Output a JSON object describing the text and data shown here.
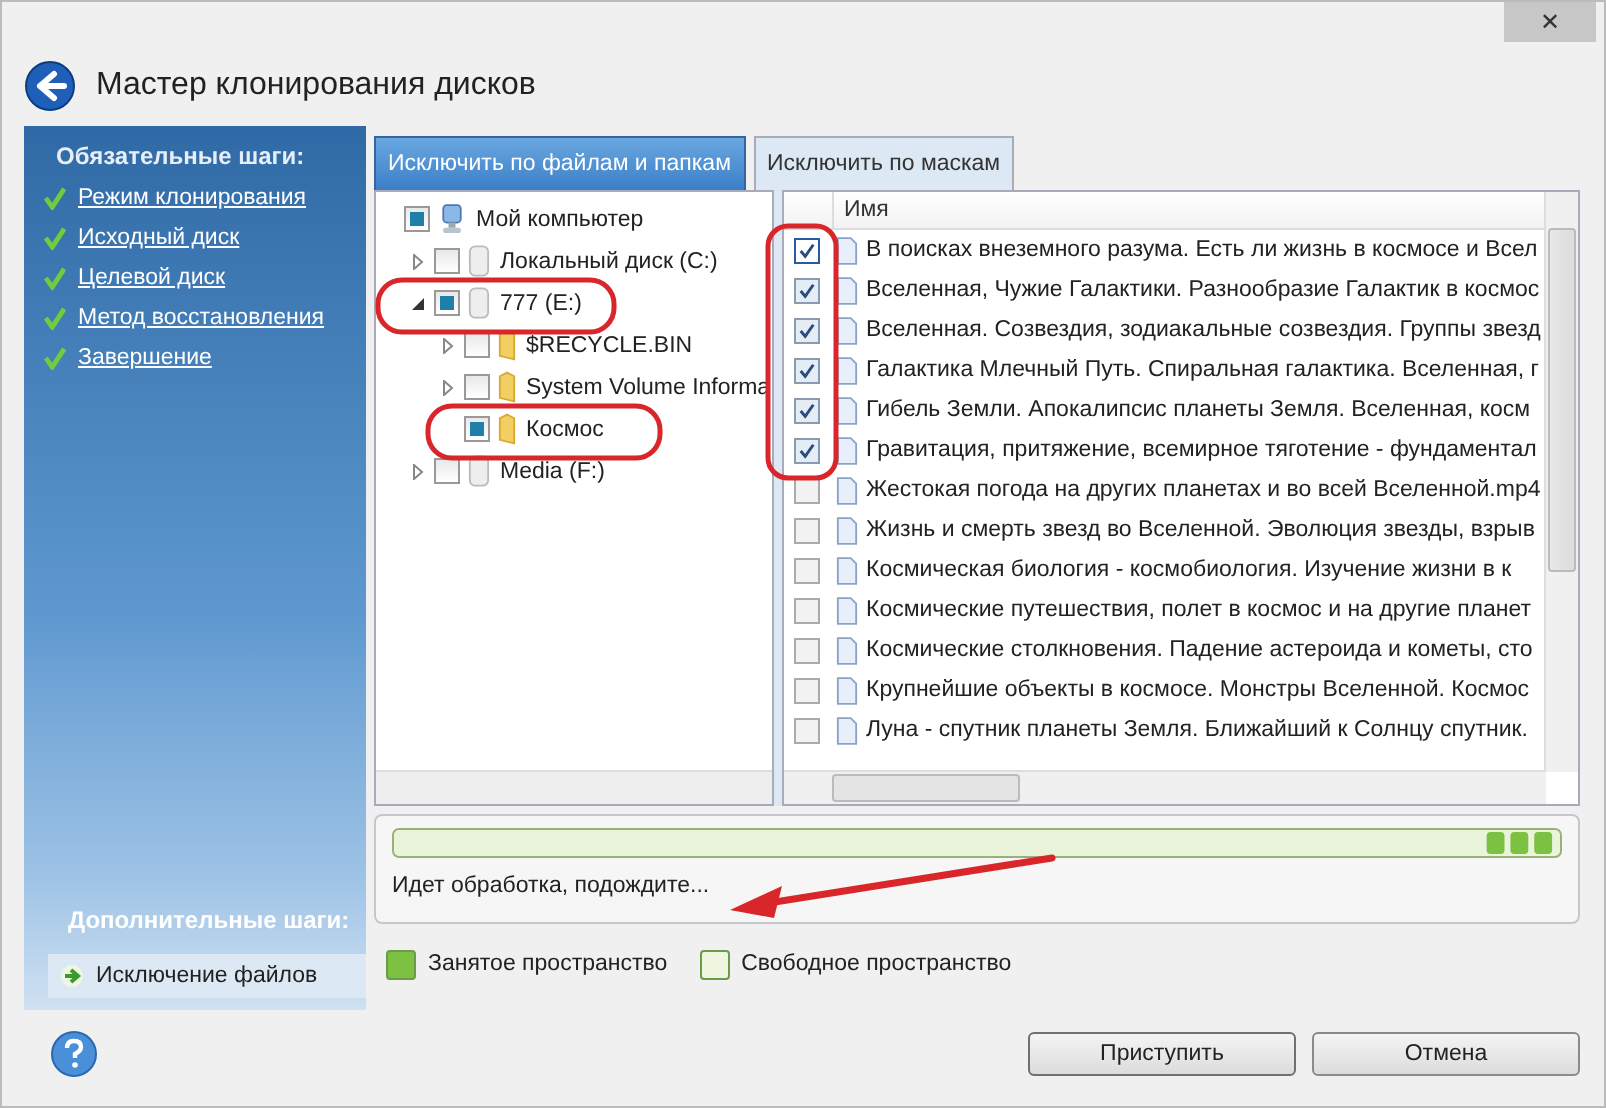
{
  "window": {
    "title": "Мастер клонирования дисков",
    "close": "✕"
  },
  "sidebar": {
    "required_heading": "Обязательные шаги:",
    "required_steps": [
      {
        "label": "Режим клонирования",
        "done": true
      },
      {
        "label": "Исходный диск",
        "done": true
      },
      {
        "label": "Целевой диск",
        "done": true
      },
      {
        "label": "Метод восстановления",
        "done": true
      },
      {
        "label": "Завершение",
        "done": true
      }
    ],
    "optional_heading": "Дополнительные шаги:",
    "optional_steps": [
      {
        "label": "Исключение файлов",
        "selected": true
      }
    ]
  },
  "tabs": [
    {
      "label": "Исключить по файлам и папкам",
      "selected": true
    },
    {
      "label": "Исключить по маскам",
      "selected": false
    }
  ],
  "tree": [
    {
      "label": "Мой компьютер",
      "kind": "computer",
      "checked": true,
      "children": [
        {
          "label": "Локальный диск (C:)",
          "kind": "drive",
          "checked": false,
          "expanded": false
        },
        {
          "label": "777 (E:)",
          "kind": "drive",
          "checked": true,
          "expanded": true,
          "children": [
            {
              "label": "$RECYCLE.BIN",
              "kind": "folder",
              "checked": false,
              "expanded": false
            },
            {
              "label": "System Volume Informa",
              "kind": "folder",
              "checked": false,
              "expanded": false
            },
            {
              "label": "Космос",
              "kind": "folder",
              "checked": true
            }
          ]
        },
        {
          "label": "Media (F:)",
          "kind": "drive",
          "checked": false,
          "expanded": false
        }
      ]
    }
  ],
  "file_list": {
    "column": "Имя",
    "rows": [
      {
        "name": "В поисках внеземного разума. Есть ли жизнь в космосе и Всел",
        "checked": true
      },
      {
        "name": "Вселенная, Чужие Галактики. Разнообразие Галактик в космос",
        "checked": true
      },
      {
        "name": "Вселенная. Созвездия, зодиакальные созвездия. Группы звезд",
        "checked": true
      },
      {
        "name": "Галактика Млечный Путь. Спиральная галактика. Вселенная, г",
        "checked": true
      },
      {
        "name": "Гибель Земли. Апокалипсис планеты Земля. Вселенная, косм",
        "checked": true
      },
      {
        "name": "Гравитация, притяжение, всемирное тяготение - фундаментал",
        "checked": true
      },
      {
        "name": "Жестокая погода на других планетах и во всей Вселенной.mp4",
        "checked": false
      },
      {
        "name": "Жизнь и смерть звезд во Вселенной. Эволюция звезды, взрыв",
        "checked": false
      },
      {
        "name": "Космическая биология - космобиология. Изучение жизни в к",
        "checked": false
      },
      {
        "name": "Космические путешествия, полет в космос и на другие планет",
        "checked": false
      },
      {
        "name": "Космические столкновения. Падение астероида и кометы, сто",
        "checked": false
      },
      {
        "name": "Крупнейшие объекты в космосе. Монстры Вселенной. Космос",
        "checked": false
      },
      {
        "name": "Луна - спутник планеты Земля. Ближайший к Солнцу спутник.",
        "checked": false
      }
    ]
  },
  "progress": {
    "status": "Идет обработка, подождите..."
  },
  "legend": [
    {
      "label": "Занятое пространство",
      "color": "#7cc142"
    },
    {
      "label": "Свободное пространство",
      "color": "#eef6e0"
    }
  ],
  "buttons": [
    {
      "label": "Приступить",
      "kind": "primary"
    },
    {
      "label": "Отмена",
      "kind": "cancel"
    }
  ]
}
